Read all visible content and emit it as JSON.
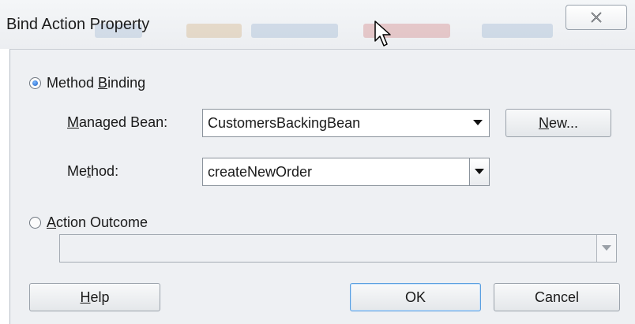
{
  "window": {
    "title": "Bind Action Property"
  },
  "icons": {
    "close": "close-x-icon",
    "cursor": "mouse-pointer-icon"
  },
  "method_binding": {
    "label_pre": "Method ",
    "label_mn": "B",
    "label_post": "inding",
    "selected": true
  },
  "managed_bean": {
    "label_mn": "M",
    "label_post": "anaged Bean:",
    "value": "CustomersBackingBean",
    "new_mn": "N",
    "new_post": "ew..."
  },
  "method": {
    "label_pre": "Me",
    "label_mn": "t",
    "label_post": "hod:",
    "value": "createNewOrder"
  },
  "action_outcome": {
    "label_mn": "A",
    "label_post": "ction Outcome",
    "selected": false,
    "value": ""
  },
  "buttons": {
    "help_mn": "H",
    "help_post": "elp",
    "ok": "OK",
    "cancel": "Cancel"
  },
  "colors": {
    "default_button_border": "#5a9fe0",
    "dialog_background": "#eef0f3"
  }
}
